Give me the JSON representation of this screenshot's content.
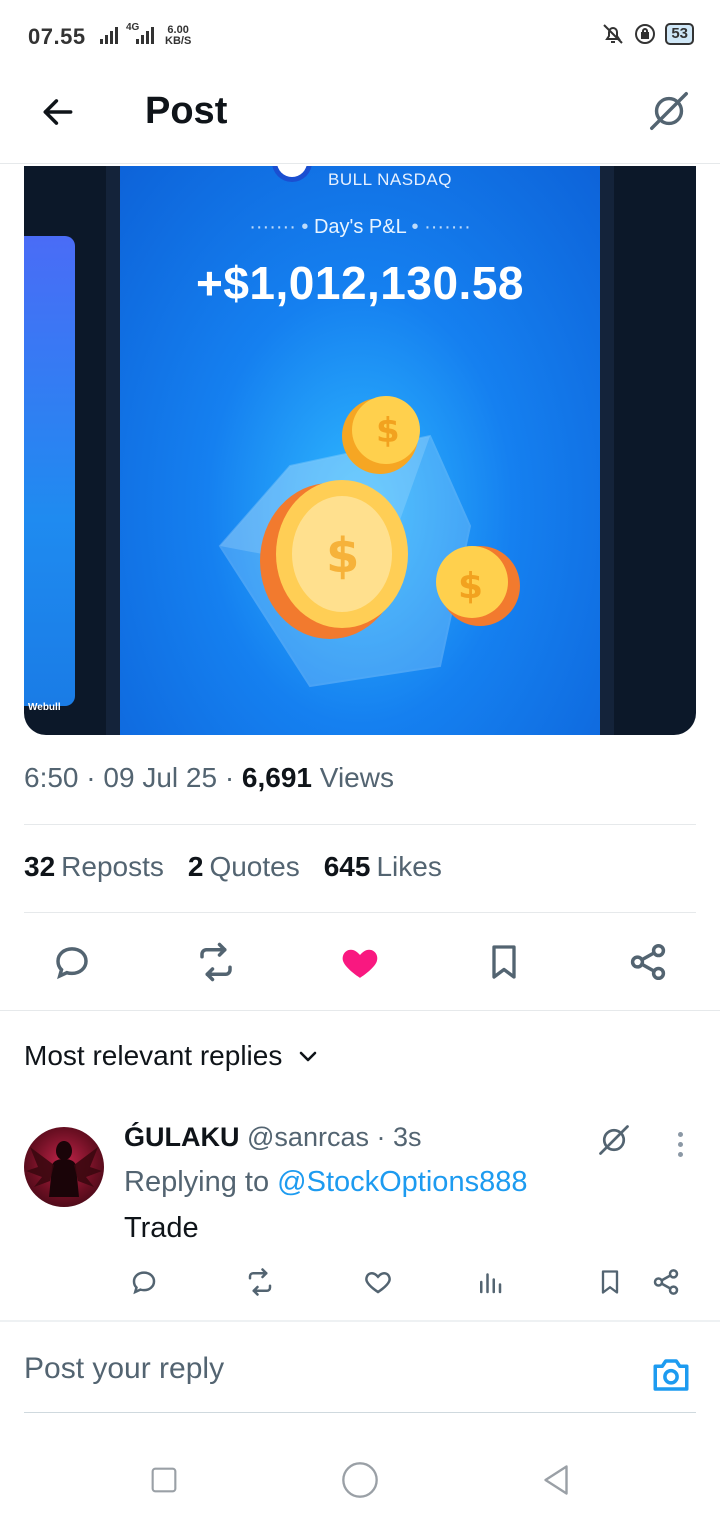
{
  "status_bar": {
    "time": "07.55",
    "network": "4G",
    "speed_value": "6.00",
    "speed_unit": "KB/S",
    "battery": "53"
  },
  "header": {
    "title": "Post",
    "back_icon": "arrow-left-icon",
    "grok_icon": "grok-icon"
  },
  "media": {
    "brand_label": "Webull",
    "account_label": "BULL NASDAQ",
    "pnl_label": "Day's P&L",
    "pnl_value": "+$1,012,130.58"
  },
  "post_meta": {
    "time": "6:50",
    "date": "09 Jul 25",
    "views_count": "6,691",
    "views_label": "Views",
    "separator": "·"
  },
  "stats": {
    "reposts_count": "32",
    "reposts_label": "Reposts",
    "quotes_count": "2",
    "quotes_label": "Quotes",
    "likes_count": "645",
    "likes_label": "Likes"
  },
  "actions": {
    "icons": [
      "reply-icon",
      "repost-icon",
      "like-icon",
      "bookmark-icon",
      "share-icon"
    ],
    "liked": true,
    "like_color": "#f91880"
  },
  "replies": {
    "sort_label": "Most relevant replies",
    "items": [
      {
        "display_name": "ǴULAKU",
        "handle": "@sanrcas",
        "time": "· 3s",
        "replying_prefix": "Replying to",
        "replying_to": "@StockOptions888",
        "text": "Trade"
      }
    ]
  },
  "compose": {
    "placeholder": "Post your reply"
  },
  "colors": {
    "accent": "#1d9bf0",
    "text_primary": "#0f1419",
    "text_secondary": "#536471",
    "like": "#f91880"
  }
}
